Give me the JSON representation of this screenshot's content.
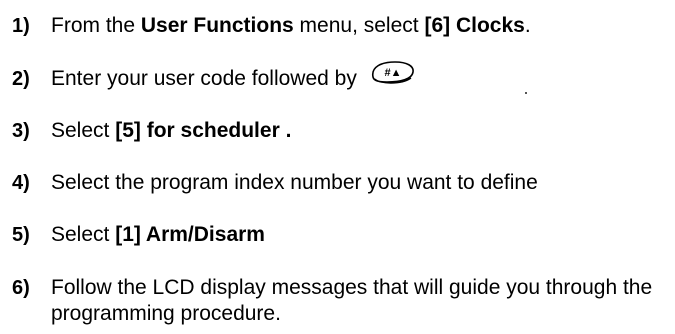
{
  "steps": [
    {
      "number": "1)",
      "text_1": "From the ",
      "bold_1": "User Functions",
      "text_2": " menu, select ",
      "bold_2": "[6] Clocks",
      "text_3": "."
    },
    {
      "number": "2)",
      "text_1": "Enter your user code followed by",
      "key_label": "#▲"
    },
    {
      "number": "3)",
      "text_1": "Select ",
      "bold_1": "[5] for scheduler ."
    },
    {
      "number": "4)",
      "text_1": "Select the program index number you want to define"
    },
    {
      "number": "5)",
      "text_1": "Select ",
      "bold_1": "[1] Arm/Disarm"
    },
    {
      "number": "6)",
      "text_1": "Follow the LCD display messages that will guide you through the programming procedure."
    }
  ]
}
